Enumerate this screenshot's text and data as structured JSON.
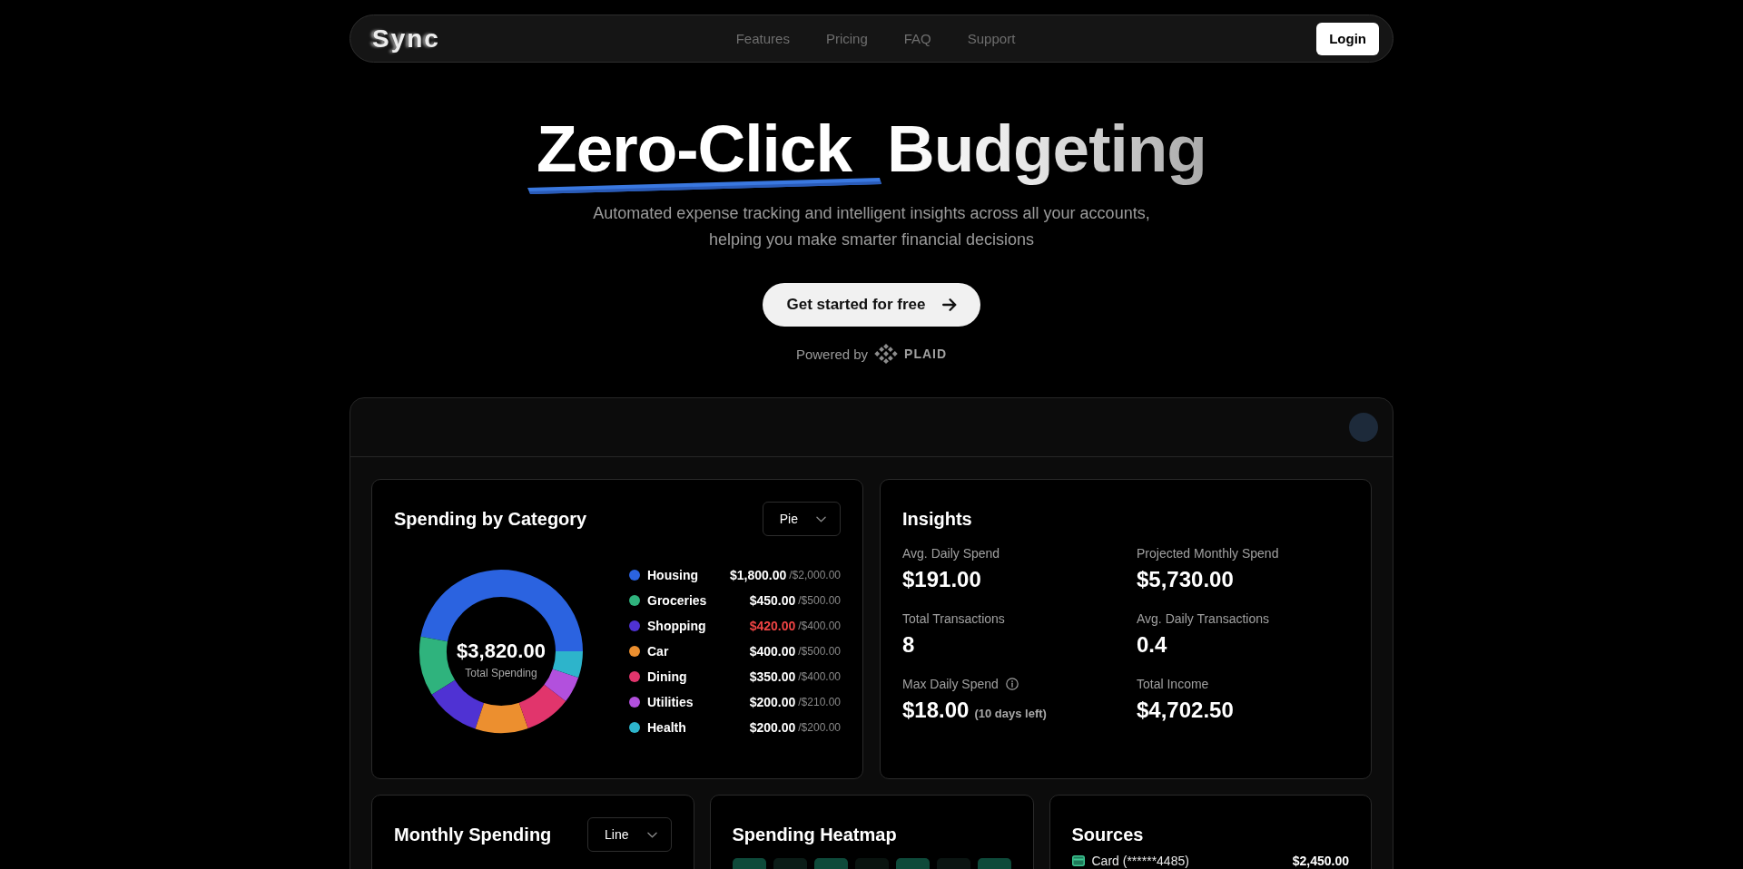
{
  "nav": {
    "logo": "Sync",
    "links": [
      {
        "label": "Features"
      },
      {
        "label": "Pricing"
      },
      {
        "label": "FAQ"
      },
      {
        "label": "Support"
      }
    ],
    "login": "Login"
  },
  "hero": {
    "title": [
      {
        "text": "Zero-Click",
        "kind": "underlined"
      },
      {
        "text": "Budgeting",
        "kind": "gradient"
      }
    ],
    "subtitle": "Automated expense tracking and intelligent insights across all your accounts, helping you make smarter financial decisions",
    "cta": "Get started for free",
    "powered_by": "Powered by",
    "partner": "PLAID"
  },
  "dashboard": {
    "spending_by_category": {
      "title": "Spending by Category",
      "view": "Pie",
      "total": "$3,820.00",
      "total_label": "Total Spending",
      "chart_data": {
        "type": "donut",
        "categories": [
          "Housing",
          "Groceries",
          "Shopping",
          "Car",
          "Dining",
          "Utilities",
          "Health"
        ],
        "values": [
          47.12,
          11.78,
          10.99,
          10.47,
          9.16,
          5.24,
          5.24
        ]
      },
      "legend": [
        {
          "color": "#2b63e0",
          "amount": "$1,800.00",
          "budget": "/$2,000.00",
          "over_budget": false
        },
        {
          "color": "#2fb37d",
          "amount": "$450.00",
          "budget": "/$500.00",
          "over_budget": false
        },
        {
          "color": "#4f32d3",
          "amount": "$420.00",
          "budget": "/$400.00",
          "over_budget": true
        },
        {
          "color": "#ec8f2f",
          "amount": "$400.00",
          "budget": "/$500.00",
          "over_budget": false
        },
        {
          "color": "#e1356c",
          "amount": "$350.00",
          "budget": "/$400.00",
          "over_budget": false
        },
        {
          "color": "#b250dd",
          "amount": "$200.00",
          "budget": "/$210.00",
          "over_budget": false
        },
        {
          "color": "#2db4cb",
          "amount": "$200.00",
          "budget": "/$200.00",
          "over_budget": false
        }
      ]
    },
    "insights": {
      "title": "Insights",
      "stats": [
        {
          "label": "Avg. Daily Spend",
          "value": "$191.00",
          "has_info": false
        },
        {
          "label": "Projected Monthly Spend",
          "value": "$5,730.00",
          "has_info": false
        },
        {
          "label": "Total Transactions",
          "value": "8",
          "has_info": false
        },
        {
          "label": "Avg. Daily Transactions",
          "value": "0.4",
          "has_info": false
        },
        {
          "label": "Max Daily Spend",
          "value": "$18.00",
          "note": "(10 days left)",
          "has_info": true
        },
        {
          "label": "Total Income",
          "value": "$4,702.50",
          "has_info": false
        }
      ]
    },
    "monthly_spending": {
      "title": "Monthly Spending",
      "view": "Line"
    },
    "heatmap": {
      "title": "Spending Heatmap",
      "cells": [
        {
          "color": "#0e4a3a"
        },
        {
          "color": "#0b1c17"
        },
        {
          "color": "#0e4a3a"
        },
        {
          "color": "#09130f"
        },
        {
          "color": "#0e4a3a"
        },
        {
          "color": "#0b1512"
        },
        {
          "color": "#0e4a3a"
        }
      ]
    },
    "sources": {
      "title": "Sources",
      "items": [
        {
          "name": "Card (******4485)",
          "amount": "$2,450.00"
        }
      ]
    }
  }
}
